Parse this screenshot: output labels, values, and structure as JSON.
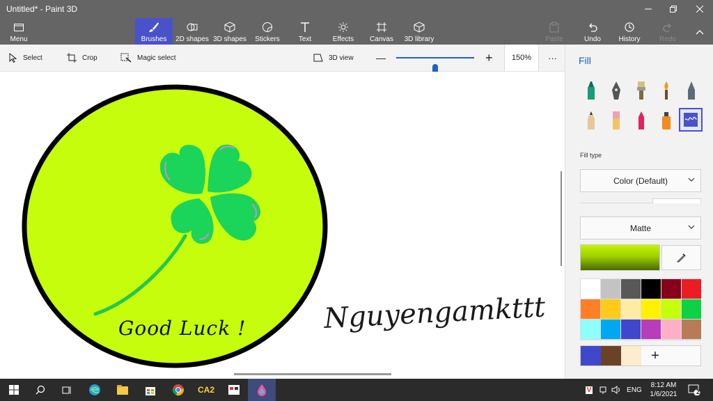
{
  "window": {
    "title": "Untitled* - Paint 3D"
  },
  "ribbon": {
    "menu": "Menu",
    "tools": [
      {
        "label": "Brushes",
        "icon": "brush-icon",
        "active": true
      },
      {
        "label": "2D shapes",
        "icon": "2d-shapes-icon"
      },
      {
        "label": "3D shapes",
        "icon": "3d-shapes-icon"
      },
      {
        "label": "Stickers",
        "icon": "stickers-icon"
      },
      {
        "label": "Text",
        "icon": "text-icon"
      },
      {
        "label": "Effects",
        "icon": "effects-icon"
      },
      {
        "label": "Canvas",
        "icon": "canvas-icon"
      },
      {
        "label": "3D library",
        "icon": "3d-library-icon"
      }
    ],
    "paste": "Paste",
    "undo": "Undo",
    "history": "History",
    "redo": "Redo"
  },
  "toolbar": {
    "select": "Select",
    "crop": "Crop",
    "magic_select": "Magic select",
    "view_3d": "3D view",
    "zoom_minus": "—",
    "zoom_plus": "+",
    "zoom_level": 0.5,
    "zoom_value": "150%",
    "more": "···"
  },
  "canvas": {
    "text_good_luck": "Good Luck !",
    "signature": "Nguyengamkttt"
  },
  "panel": {
    "title": "Fill",
    "brushes": [
      {
        "name": "marker-icon",
        "selected": false
      },
      {
        "name": "calligraphy-pen-icon",
        "selected": false
      },
      {
        "name": "oil-brush-icon",
        "selected": false
      },
      {
        "name": "watercolor-icon",
        "selected": false
      },
      {
        "name": "pixel-pen-icon",
        "selected": false
      },
      {
        "name": "pencil-icon",
        "selected": false
      },
      {
        "name": "eraser-icon",
        "selected": false
      },
      {
        "name": "crayon-icon",
        "selected": false
      },
      {
        "name": "spray-can-icon",
        "selected": false
      },
      {
        "name": "fill-icon",
        "selected": true
      }
    ],
    "fill_type_label": "Fill type",
    "fill_type_value": "Color (Default)",
    "material_value": "Matte",
    "current_color": "#c5f300",
    "palette": [
      "#ffffff",
      "#c3c3c3",
      "#585858",
      "#000000",
      "#88001b",
      "#ec1c24",
      "#ff7f27",
      "#ffca18",
      "#fdeca6",
      "#fff200",
      "#c4ff0e",
      "#0ed145",
      "#8cfffb",
      "#00a8f3",
      "#3f48cc",
      "#b83dba",
      "#ffaec8",
      "#b97a56"
    ],
    "custom_colors": [
      "#3f48cc",
      "#6b4226",
      "#fdeccd"
    ],
    "add_color": "+"
  },
  "taskbar": {
    "apps": [
      "windows-start-icon",
      "search-icon",
      "task-view-icon",
      "edge-icon",
      "file-explorer-icon",
      "store-icon",
      "chrome-icon",
      "ca2-app",
      "window-app-icon",
      "paint-3d-icon"
    ],
    "ca2_label": "CA2",
    "tray_v": "V",
    "language": "ENG",
    "time": "8:12 AM",
    "date": "1/6/2021",
    "notifications": "2"
  }
}
